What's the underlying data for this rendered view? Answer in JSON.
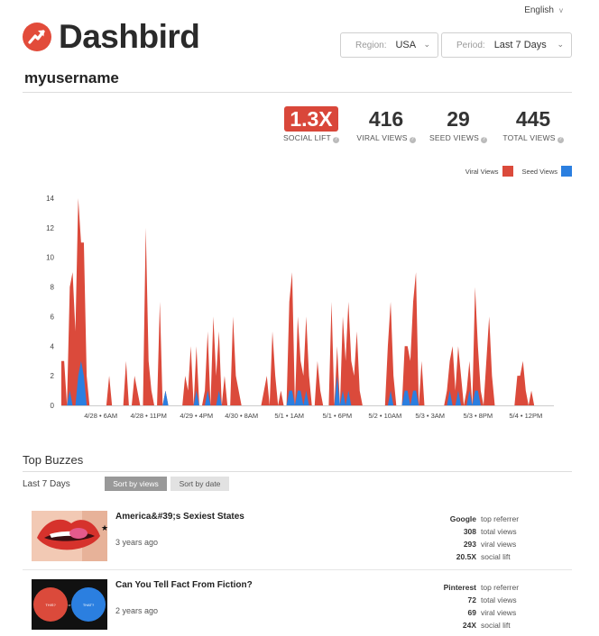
{
  "header": {
    "language": "English",
    "brand": "Dashbird",
    "region": {
      "label": "Region:",
      "value": "USA"
    },
    "period": {
      "label": "Period:",
      "value": "Last 7 Days"
    },
    "username": "myusername"
  },
  "stats": [
    {
      "value": "1.3X",
      "label": "SOCIAL LIFT",
      "highlight": true
    },
    {
      "value": "416",
      "label": "VIRAL VIEWS"
    },
    {
      "value": "29",
      "label": "SEED VIEWS"
    },
    {
      "value": "445",
      "label": "TOTAL VIEWS"
    }
  ],
  "legend": [
    {
      "name": "Viral Views",
      "color": "#db4a3b"
    },
    {
      "name": "Seed Views",
      "color": "#2b7fe0"
    }
  ],
  "chart_data": {
    "type": "area",
    "ylim": [
      0,
      14
    ],
    "yticks": [
      0,
      2,
      4,
      6,
      8,
      10,
      12,
      14
    ],
    "xticks": [
      "4/28 • 6AM",
      "4/28 • 11PM",
      "4/29 • 4PM",
      "4/30 • 8AM",
      "5/1 • 1AM",
      "5/1 • 6PM",
      "5/2 • 10AM",
      "5/3 • 3AM",
      "5/3 • 8PM",
      "5/4 • 12PM"
    ],
    "xtick_index": [
      14,
      31,
      48,
      64,
      81,
      98,
      115,
      131,
      148,
      165
    ],
    "series": [
      {
        "name": "Viral Views",
        "color": "#db4a3b",
        "values": [
          3,
          3,
          0,
          8,
          9,
          5,
          14,
          11,
          11,
          2,
          0,
          0,
          0,
          0,
          0,
          0,
          0,
          2,
          0,
          0,
          0,
          0,
          0,
          3,
          0,
          0,
          2,
          1,
          0,
          0,
          12,
          3,
          1,
          0,
          0,
          7,
          0,
          1,
          0,
          0,
          0,
          0,
          0,
          0,
          2,
          1,
          4,
          0,
          4,
          0,
          0,
          1,
          5,
          0,
          6,
          2,
          5,
          0,
          2,
          0,
          0,
          6,
          2,
          1,
          0,
          0,
          0,
          0,
          0,
          0,
          0,
          0,
          1,
          2,
          0,
          5,
          2,
          0,
          1,
          0,
          0,
          7,
          9,
          0,
          6,
          3,
          2,
          6,
          2,
          0,
          0,
          3,
          1,
          0,
          0,
          0,
          7,
          0,
          4,
          0,
          6,
          3,
          7,
          3,
          2,
          5,
          1,
          0,
          0,
          0,
          0,
          0,
          0,
          0,
          0,
          0,
          4,
          7,
          2,
          0,
          0,
          0,
          4,
          4,
          3,
          7,
          9,
          0,
          3,
          0,
          0,
          0,
          0,
          0,
          0,
          0,
          0,
          1,
          3,
          4,
          1,
          4,
          2,
          0,
          1,
          3,
          0,
          8,
          4,
          1,
          0,
          3,
          6,
          2,
          0,
          0,
          0,
          0,
          0,
          0,
          0,
          0,
          2,
          2,
          3,
          1,
          0,
          1,
          0,
          0,
          0,
          0,
          0,
          0,
          0,
          0
        ],
        "note": "estimated per-interval views"
      },
      {
        "name": "Seed Views",
        "color": "#2b7fe0",
        "values": [
          0,
          0,
          0,
          1,
          0,
          0,
          2,
          3,
          2,
          0,
          0,
          0,
          0,
          0,
          0,
          0,
          0,
          0,
          0,
          0,
          0,
          0,
          0,
          0,
          0,
          0,
          0,
          0,
          0,
          0,
          0,
          0,
          0,
          0,
          0,
          0,
          0,
          1,
          0,
          0,
          0,
          0,
          0,
          0,
          0,
          0,
          0,
          0,
          1,
          0,
          0,
          0,
          1,
          0,
          0,
          0,
          1,
          0,
          0,
          0,
          0,
          0,
          0,
          0,
          0,
          0,
          0,
          0,
          0,
          0,
          0,
          0,
          0,
          0,
          0,
          0,
          0,
          0,
          0,
          0,
          0,
          1,
          1,
          0,
          1,
          1,
          0,
          1,
          0,
          0,
          0,
          0,
          0,
          0,
          0,
          0,
          0,
          0,
          2,
          0,
          1,
          0,
          1,
          0,
          0,
          0,
          0,
          0,
          0,
          0,
          0,
          0,
          0,
          0,
          0,
          0,
          0,
          1,
          0,
          0,
          0,
          0,
          1,
          1,
          0,
          1,
          1,
          0,
          0,
          0,
          0,
          0,
          0,
          0,
          0,
          0,
          0,
          0,
          1,
          0,
          0,
          1,
          0,
          0,
          0,
          1,
          0,
          1,
          1,
          0,
          0,
          0,
          0,
          0,
          0,
          0,
          0,
          0,
          0,
          0,
          0,
          0,
          0,
          0,
          0,
          0,
          0,
          0,
          0,
          0,
          0,
          0,
          0,
          0,
          0,
          0
        ]
      }
    ]
  },
  "top_buzzes": {
    "title": "Top Buzzes",
    "period": "Last 7 Days",
    "sort_views": "Sort by views",
    "sort_date": "Sort by date",
    "items": [
      {
        "title": "America&#39;s Sexiest States",
        "age": "3 years ago",
        "referrer": "Google",
        "referrer_label": "top referrer",
        "total": "308",
        "total_label": "total views",
        "viral": "293",
        "viral_label": "viral views",
        "lift": "20.5X",
        "lift_label": "social lift"
      },
      {
        "title": "Can You Tell Fact From Fiction?",
        "age": "2 years ago",
        "thumb_left": "THIS?",
        "thumb_mid": "or",
        "thumb_right": "THAT?",
        "referrer": "Pinterest",
        "referrer_label": "top referrer",
        "total": "72",
        "total_label": "total views",
        "viral": "69",
        "viral_label": "viral views",
        "lift": "24X",
        "lift_label": "social lift"
      }
    ]
  }
}
